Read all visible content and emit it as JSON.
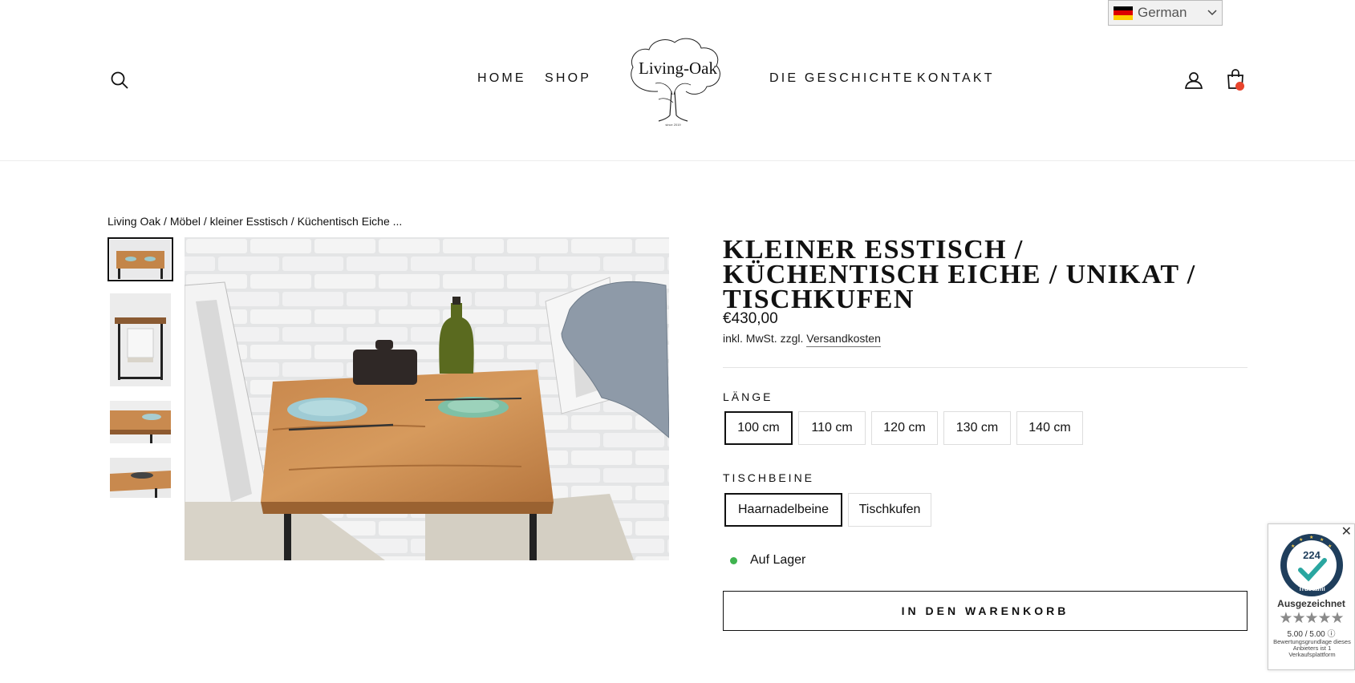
{
  "language_selector": {
    "label": "German"
  },
  "header": {
    "nav": {
      "home": "HOME",
      "shop": "SHOP",
      "story": "DIE GESCHICHTE",
      "contact": "KONTAKT"
    },
    "logo": {
      "name": "Living-Oak",
      "tagline": "since 2019"
    }
  },
  "breadcrumb": {
    "items": [
      "Living Oak",
      "Möbel",
      "kleiner Esstisch",
      "Küchentisch Eiche ..."
    ],
    "separator": " / "
  },
  "gallery": {
    "thumbnails": [
      "table-top-view",
      "table-front-view",
      "table-edge-closeup",
      "table-wood-detail"
    ],
    "main_image": "small oak dining table with two white chairs against a white brick wall"
  },
  "product": {
    "title": "KLEINER ESSTISCH / KÜCHENTISCH EICHE / UNIKAT / TISCHKUFEN",
    "price": "€430,00",
    "tax_prefix": "inkl. MwSt. zzgl. ",
    "shipping_link": "Versandkosten",
    "options": [
      {
        "label": "LÄNGE",
        "values": [
          "100 cm",
          "110 cm",
          "120 cm",
          "130 cm",
          "140 cm"
        ],
        "selected": "100 cm"
      },
      {
        "label": "TISCHBEINE",
        "values": [
          "Haarnadelbeine",
          "Tischkufen"
        ],
        "selected": "Haarnadelbeine"
      }
    ],
    "stock_status": "Auf Lager",
    "add_to_cart": "IN DEN WARENKORB"
  },
  "trust_widget": {
    "count": "224",
    "brand": "Trustami",
    "award": "Ausgezeichnet",
    "rating": 5.0,
    "score_text": "5.00 / 5.00",
    "note": "Bewertungsgrundlage dieses Anbieters ist 1 Verkaufsplattform"
  },
  "colors": {
    "accent_dot": "#e8442c",
    "stock_green": "#3fb34f",
    "text": "#111111"
  }
}
